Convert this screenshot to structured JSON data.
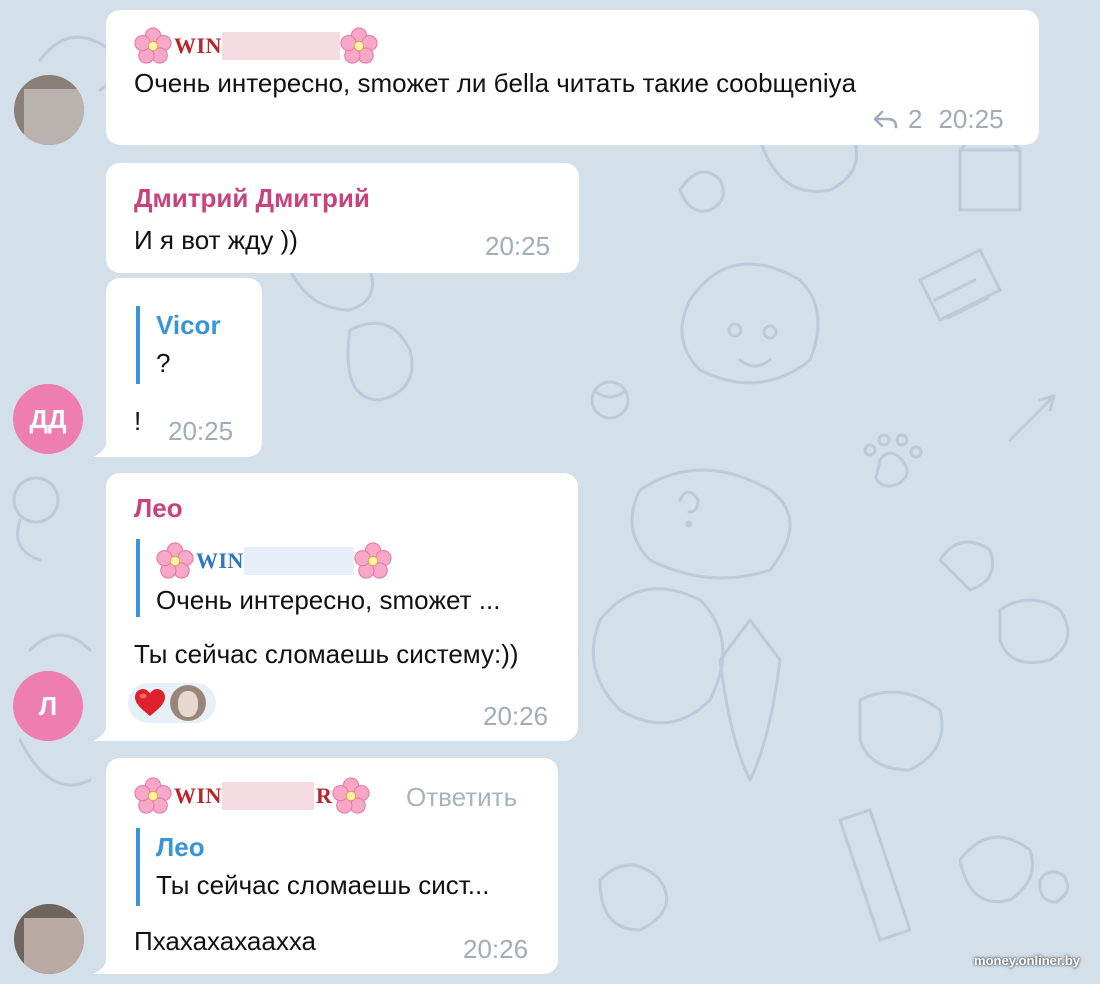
{
  "messages": [
    {
      "sender_nick": {
        "prefix": "Win",
        "suffix": ""
      },
      "text": "Очень интересно, smoжет ли бella читать такие coobщeniya",
      "reply_count": "2",
      "time": "20:25"
    },
    {
      "sender": "Дмитрий Дмитрий",
      "text": "И я вот жду ))",
      "time": "20:25"
    },
    {
      "quote": {
        "name": "Vicor",
        "text": "?"
      },
      "text": "!",
      "time": "20:25",
      "avatar_initials": "ДД"
    },
    {
      "sender": "Лео",
      "quote": {
        "nick_prefix": "Win",
        "text": "Очень интересно, smoжет ..."
      },
      "text": "Ты сейчас сломаешь систему:))",
      "time": "20:26",
      "avatar_initials": "Л"
    },
    {
      "sender_nick": {
        "prefix": "Win",
        "suffix": "r"
      },
      "reply_action": "Ответить",
      "quote": {
        "name": "Лео",
        "text": "Ты сейчас сломаешь сист..."
      },
      "text": "Пхахахахаахха",
      "time": "20:26"
    }
  ],
  "colors": {
    "background": "#d3dfe9",
    "pattern": "#bccbd8",
    "bubble": "#ffffff",
    "sender_pink": "#c8437e",
    "reply_blue": "#3a95d6",
    "time_gray": "#a0acb8",
    "avatar_pink": "#ee7eb0",
    "nick_red": "#b8262b",
    "nick_blue": "#2b78c0"
  },
  "icons": {
    "reply": "reply-arrow-icon",
    "flower": "cherry-blossom-emoji",
    "reaction": "red-heart-emoji"
  },
  "watermark": "money.onliner.by"
}
